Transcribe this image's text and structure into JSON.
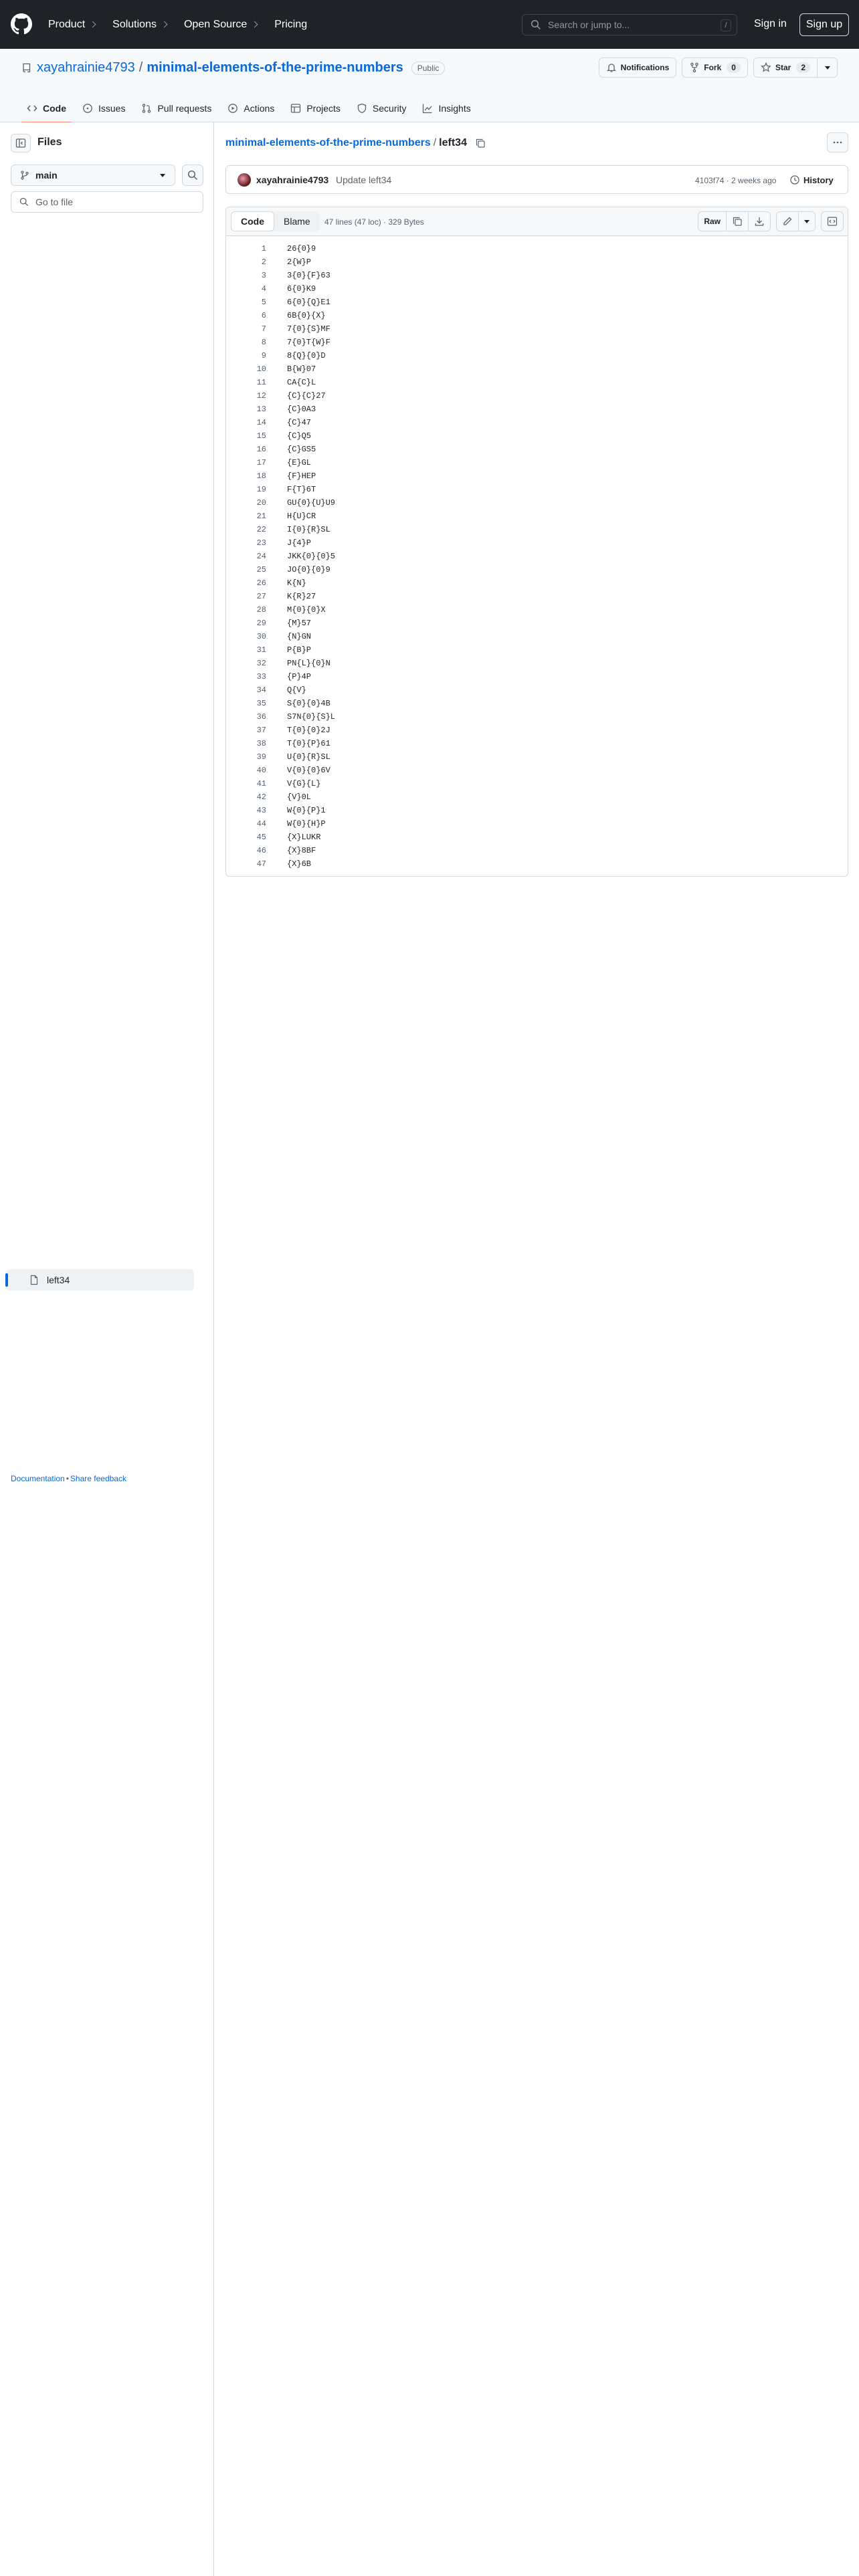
{
  "header": {
    "nav": [
      "Product",
      "Solutions",
      "Open Source",
      "Pricing"
    ],
    "search_placeholder": "Search or jump to...",
    "search_key": "/",
    "signin": "Sign in",
    "signup": "Sign up"
  },
  "repo": {
    "owner": "xayahrainie4793",
    "separator": "/",
    "name": "minimal-elements-of-the-prime-numbers",
    "visibility": "Public",
    "notifications": "Notifications",
    "fork_label": "Fork",
    "fork_count": "0",
    "star_label": "Star",
    "star_count": "2",
    "tabs": [
      "Code",
      "Issues",
      "Pull requests",
      "Actions",
      "Projects",
      "Security",
      "Insights"
    ]
  },
  "sidebar": {
    "title": "Files",
    "branch": "main",
    "goto_placeholder": "Go to file",
    "tree": [
      "left34"
    ],
    "footer_docs": "Documentation",
    "footer_sep": "•",
    "footer_feedback": "Share feedback"
  },
  "main": {
    "breadcrumb_repo": "minimal-elements-of-the-prime-numbers",
    "breadcrumb_sep": "/",
    "breadcrumb_file": "left34",
    "commit": {
      "author": "xayahrainie4793",
      "message": "Update left34",
      "meta": "4103f74 · 2 weeks ago",
      "history": "History"
    },
    "file": {
      "tab_code": "Code",
      "tab_blame": "Blame",
      "meta": "47 lines (47 loc) · 329 Bytes",
      "raw": "Raw",
      "lines": [
        "26{0}9",
        "2{W}P",
        "3{0}{F}63",
        "6{0}K9",
        "6{0}{Q}E1",
        "6B{0}{X}",
        "7{0}{S}MF",
        "7{0}T{W}F",
        "8{Q}{0}D",
        "B{W}07",
        "CA{C}L",
        "{C}{C}27",
        "{C}0A3",
        "{C}47",
        "{C}Q5",
        "{C}GS5",
        "{E}GL",
        "{F}HEP",
        "F{T}6T",
        "GU{0}{U}U9",
        "H{U}CR",
        "I{0}{R}SL",
        "J{4}P",
        "JKK{0}{0}5",
        "JO{0}{0}9",
        "K{N}",
        "K{R}27",
        "M{0}{0}X",
        "{M}57",
        "{N}GN",
        "P{B}P",
        "PN{L}{0}N",
        "{P}4P",
        "Q{V}",
        "S{0}{0}4B",
        "S7N{0}{S}L",
        "T{0}{0}2J",
        "T{0}{P}61",
        "U{0}{R}SL",
        "V{0}{0}6V",
        "V{G}{L}",
        "{V}0L",
        "W{0}{P}1",
        "W{0}{H}P",
        "{X}LUKR",
        "{X}8BF",
        "{X}6B"
      ]
    }
  },
  "colors": {
    "header_bg": "#1f2328",
    "link": "#0969da",
    "tab_underline": "#fd8c73"
  }
}
